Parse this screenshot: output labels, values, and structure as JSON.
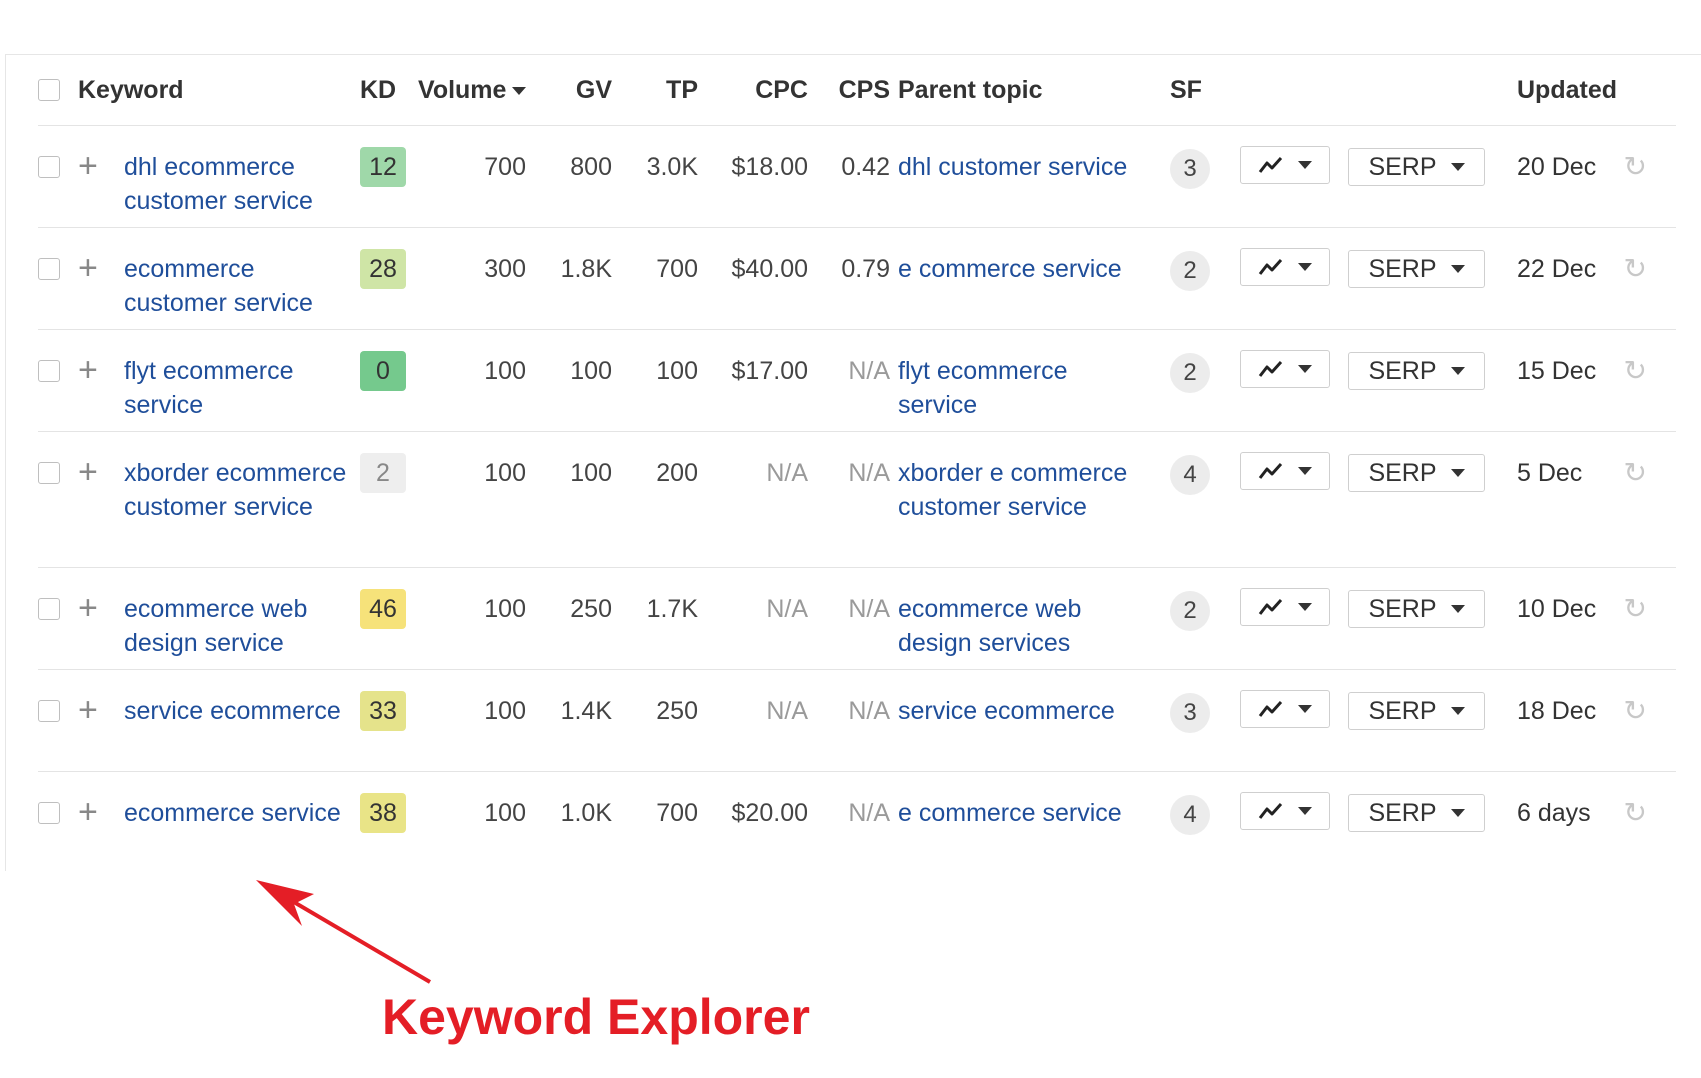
{
  "table": {
    "headers": {
      "keyword": "Keyword",
      "kd": "KD",
      "volume": "Volume",
      "gv": "GV",
      "tp": "TP",
      "cpc": "CPC",
      "cps": "CPS",
      "parent_topic": "Parent topic",
      "sf": "SF",
      "updated": "Updated"
    },
    "sorted_column": "Volume",
    "rows": [
      {
        "keyword": "dhl ecommerce customer service",
        "kd": "12",
        "kd_color": "#9fd8a9",
        "volume": "700",
        "gv": "800",
        "tp": "3.0K",
        "cpc": "$18.00",
        "cps": "0.42",
        "parent_topic": "dhl customer service",
        "sf": "3",
        "serp_label": "SERP",
        "updated": "20 Dec"
      },
      {
        "keyword": "ecommerce customer service",
        "kd": "28",
        "kd_color": "#cfe5a6",
        "volume": "300",
        "gv": "1.8K",
        "tp": "700",
        "cpc": "$40.00",
        "cps": "0.79",
        "parent_topic": "e commerce service",
        "sf": "2",
        "serp_label": "SERP",
        "updated": "22 Dec"
      },
      {
        "keyword": "flyt ecommerce service",
        "kd": "0",
        "kd_color": "#75c98d",
        "volume": "100",
        "gv": "100",
        "tp": "100",
        "cpc": "$17.00",
        "cps": "N/A",
        "parent_topic": "flyt ecommerce service",
        "sf": "2",
        "serp_label": "SERP",
        "updated": "15 Dec"
      },
      {
        "keyword": "xborder ecommerce customer service",
        "kd": "2",
        "kd_color": "#eeeeee",
        "volume": "100",
        "gv": "100",
        "tp": "200",
        "cpc": "N/A",
        "cps": "N/A",
        "parent_topic": "xborder e commerce customer service",
        "sf": "4",
        "serp_label": "SERP",
        "updated": "5 Dec"
      },
      {
        "keyword": "ecommerce web design service",
        "kd": "46",
        "kd_color": "#f6e27a",
        "volume": "100",
        "gv": "250",
        "tp": "1.7K",
        "cpc": "N/A",
        "cps": "N/A",
        "parent_topic": "ecommerce web design services",
        "sf": "2",
        "serp_label": "SERP",
        "updated": "10 Dec"
      },
      {
        "keyword": "service ecommerce",
        "kd": "33",
        "kd_color": "#e5e38b",
        "volume": "100",
        "gv": "1.4K",
        "tp": "250",
        "cpc": "N/A",
        "cps": "N/A",
        "parent_topic": "service ecommerce",
        "sf": "3",
        "serp_label": "SERP",
        "updated": "18 Dec"
      },
      {
        "keyword": "ecommerce service",
        "kd": "38",
        "kd_color": "#e9e487",
        "volume": "100",
        "gv": "1.0K",
        "tp": "700",
        "cpc": "$20.00",
        "cps": "N/A",
        "parent_topic": "e commerce service",
        "sf": "4",
        "serp_label": "SERP",
        "updated": "6 days"
      }
    ]
  },
  "annotation": {
    "caption": "Keyword Explorer",
    "color": "#e41e26"
  },
  "icons": {
    "row_add": "plus-icon",
    "trend": "trend-line-icon",
    "dropdown": "caret-down-icon",
    "refresh": "refresh-icon"
  },
  "colors": {
    "link": "#1f4e9a",
    "na_text": "#9a9a9a"
  }
}
